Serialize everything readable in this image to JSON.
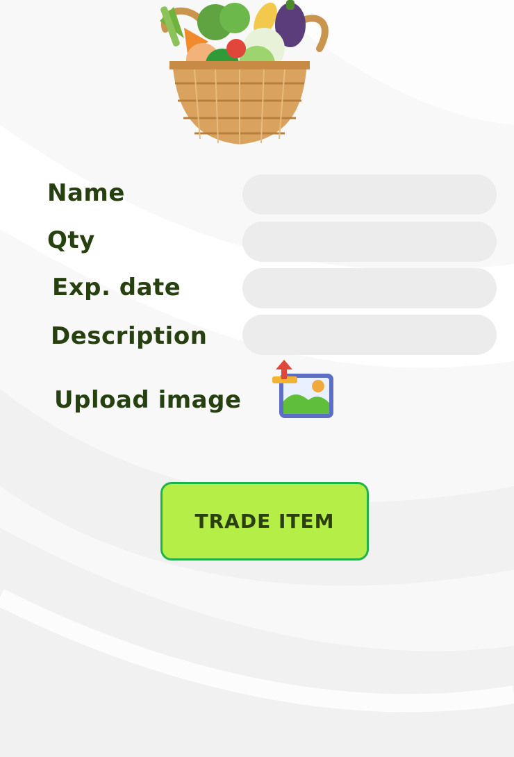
{
  "form": {
    "name_label": "Name",
    "qty_label": "Qty",
    "exp_date_label": "Exp. date",
    "description_label": "Description",
    "upload_label": "Upload image",
    "name_value": "",
    "qty_value": "",
    "exp_date_value": "",
    "description_value": ""
  },
  "actions": {
    "trade_label": "TRADE ITEM"
  },
  "icons": {
    "header_image": "vegetable-basket-icon",
    "upload": "image-upload-icon"
  },
  "colors": {
    "label_text": "#26400f",
    "field_bg": "#ececec",
    "button_bg": "#b4ee47",
    "button_border": "#1fb24a"
  }
}
